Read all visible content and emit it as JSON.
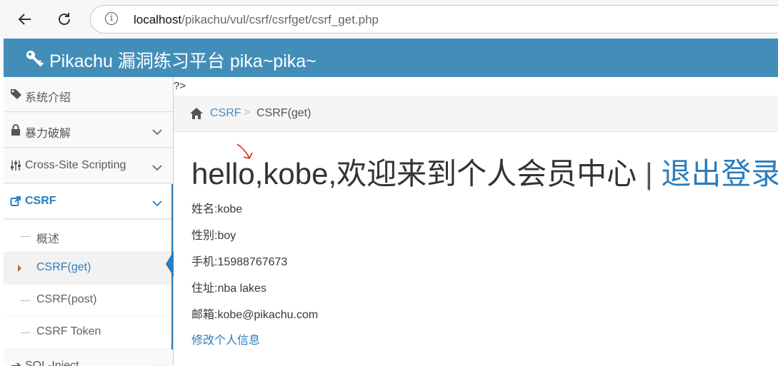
{
  "browser": {
    "url_host": "localhost",
    "url_path": "/pikachu/vul/csrf/csrfget/csrf_get.php",
    "info_glyph": "i",
    "icons": [
      "back-arrow-icon",
      "reload-icon",
      "info-icon"
    ]
  },
  "header": {
    "title": "Pikachu 漏洞练习平台 pika~pika~",
    "icon": "key-icon"
  },
  "sidebar": {
    "items": [
      {
        "label": "系统介绍",
        "icon": "tags-icon"
      },
      {
        "label": "暴力破解",
        "icon": "lock-icon"
      },
      {
        "label": "Cross-Site Scripting",
        "icon": "sliders-icon"
      },
      {
        "label": "CSRF",
        "icon": "share-icon"
      },
      {
        "label": "SQL-Inject",
        "icon": "arrows-icon"
      }
    ],
    "csrf_submenu": [
      {
        "label": "概述"
      },
      {
        "label": "CSRF(get)"
      },
      {
        "label": "CSRF(post)"
      },
      {
        "label": "CSRF Token"
      }
    ]
  },
  "page": {
    "stray_text": "?>",
    "breadcrumb": {
      "section": "CSRF",
      "separator": ">",
      "current": "CSRF(get)"
    },
    "greeting": "hello,kobe,欢迎来到个人会员中心",
    "divider": "|",
    "logout": "退出登录",
    "profile": {
      "name": "姓名:kobe",
      "gender": "性别:boy",
      "phone": "手机:15988767673",
      "address": "住址:nba lakes",
      "email": "邮箱:kobe@pikachu.com"
    },
    "edit_link": "修改个人信息"
  },
  "colors": {
    "header_bg": "#438eb9",
    "link": "#2b7dbc",
    "annotation": "#e02020"
  }
}
